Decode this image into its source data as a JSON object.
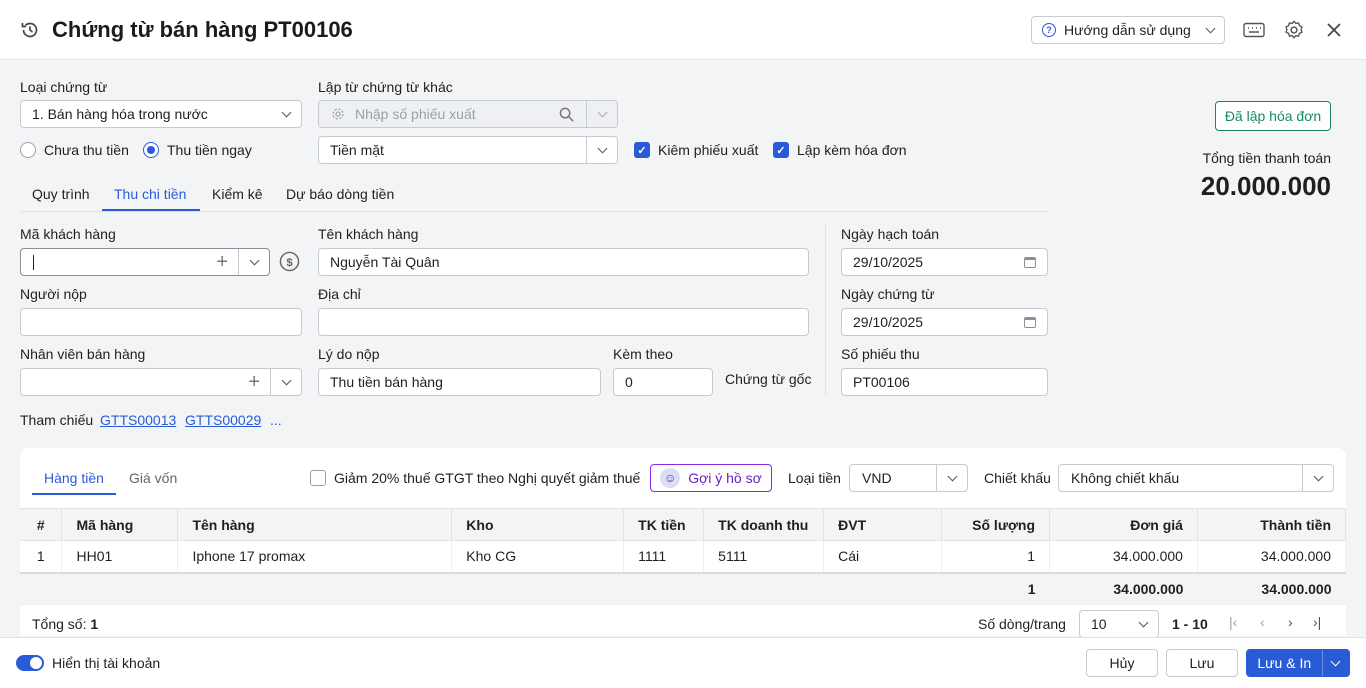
{
  "header": {
    "title": "Chứng từ bán hàng PT00106",
    "help_label": "Hướng dẫn sử dụng"
  },
  "voucher": {
    "type_label": "Loại chứng từ",
    "type_value": "1. Bán hàng hóa trong nước",
    "from_other_label": "Lập từ chứng từ khác",
    "from_other_placeholder": "Nhập số phiếu xuất",
    "payment_method": "Tiền mặt",
    "radio_unpaid": "Chưa thu tiền",
    "radio_paid": "Thu tiền ngay",
    "check_export": "Kiêm phiếu xuất",
    "check_invoice": "Lập kèm hóa đơn",
    "invoiced_button": "Đã lập hóa đơn",
    "total_label": "Tổng tiền thanh toán",
    "total_value": "20.000.000"
  },
  "tabs": [
    "Quy trình",
    "Thu chi tiền",
    "Kiểm kê",
    "Dự báo dòng tiền"
  ],
  "form": {
    "customer_code_label": "Mã khách hàng",
    "customer_code_value": "",
    "customer_name_label": "Tên khách hàng",
    "customer_name_value": "Nguyễn Tài Quân",
    "payer_label": "Người nộp",
    "payer_value": "",
    "address_label": "Địa chỉ",
    "address_value": "",
    "salesperson_label": "Nhân viên bán hàng",
    "salesperson_value": "",
    "reason_label": "Lý do nộp",
    "reason_value": "Thu tiền bán hàng",
    "attach_label": "Kèm theo",
    "attach_value": "0",
    "original_docs": "Chứng từ gốc",
    "posting_date_label": "Ngày hạch toán",
    "posting_date_value": "29/10/2025",
    "voucher_date_label": "Ngày chứng từ",
    "voucher_date_value": "29/10/2025",
    "receipt_no_label": "Số phiếu thu",
    "receipt_no_value": "PT00106",
    "reference_label": "Tham chiếu",
    "references": [
      "GTTS00013",
      "GTTS00029"
    ],
    "reference_more": "..."
  },
  "detail": {
    "tabs": [
      "Hàng tiền",
      "Giá vốn"
    ],
    "vat_reduction": "Giảm 20% thuế GTGT theo Nghị quyết giảm thuế",
    "suggest_button": "Gợi ý hồ sơ",
    "currency_label": "Loại tiền",
    "currency_value": "VND",
    "discount_label": "Chiết khấu",
    "discount_value": "Không chiết khấu",
    "columns": [
      "#",
      "Mã hàng",
      "Tên hàng",
      "Kho",
      "TK tiền",
      "TK doanh thu",
      "ĐVT",
      "Số lượng",
      "Đơn giá",
      "Thành tiền"
    ],
    "rows": [
      [
        "1",
        "HH01",
        "Iphone 17 promax",
        "Kho CG",
        "1111",
        "5111",
        "Cái",
        "1",
        "34.000.000",
        "34.000.000"
      ]
    ],
    "totals": {
      "quantity": "1",
      "unit_price": "34.000.000",
      "amount": "34.000.000"
    },
    "count_label": "Tổng số:",
    "count_value": "1",
    "rows_per_page_label": "Số dòng/trang",
    "rows_per_page_value": "10",
    "range": "1 - 10"
  },
  "footer": {
    "show_account": "Hiển thị tài khoản",
    "cancel": "Hủy",
    "save": "Lưu",
    "save_print": "Lưu & In"
  },
  "colors": {
    "accent": "#2a5bd7",
    "success": "#1a8a5c",
    "suggest": "#8a2be2"
  }
}
